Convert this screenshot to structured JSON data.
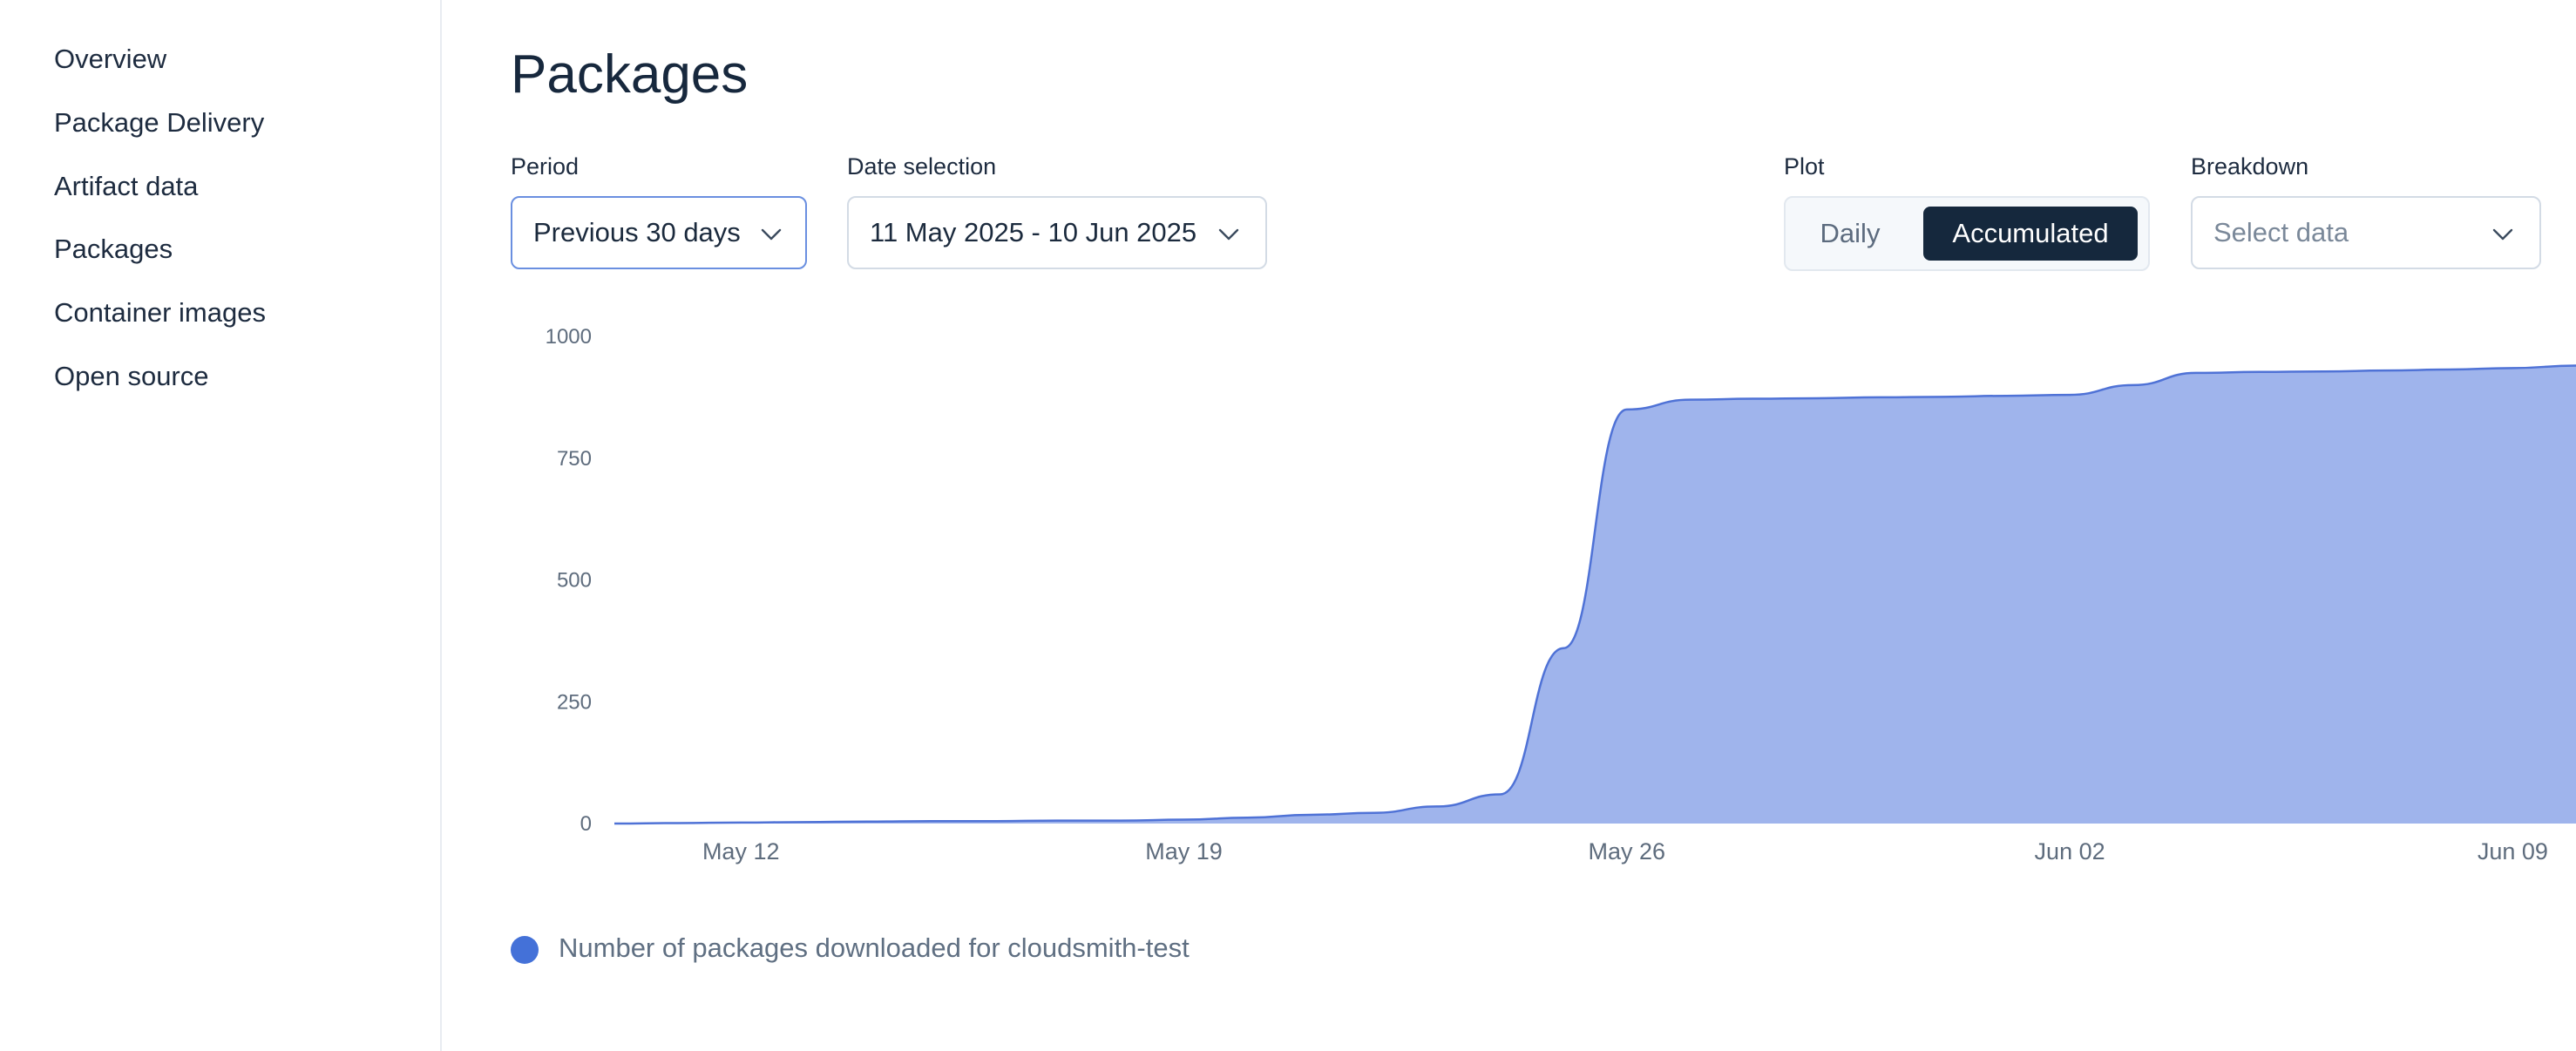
{
  "sidebar": {
    "items": [
      {
        "label": "Overview"
      },
      {
        "label": "Package Delivery"
      },
      {
        "label": "Artifact data"
      },
      {
        "label": "Packages"
      },
      {
        "label": "Container images"
      },
      {
        "label": "Open source"
      }
    ]
  },
  "main": {
    "title": "Packages",
    "period": {
      "label": "Period",
      "value": "Previous 30 days"
    },
    "date_selection": {
      "label": "Date selection",
      "value": "11 May 2025 - 10 Jun 2025"
    },
    "plot": {
      "label": "Plot",
      "options": [
        "Daily",
        "Accumulated"
      ],
      "selected": "Accumulated"
    },
    "breakdown": {
      "label": "Breakdown",
      "placeholder": "Select data"
    }
  },
  "colors": {
    "area_fill": "#9fb4ec",
    "area_stroke": "#4f72d6",
    "legend_dot": "#4471d8",
    "active_toggle": "#15283d"
  },
  "chart_data": {
    "type": "area",
    "title": "",
    "xlabel": "",
    "ylabel": "",
    "ylim": [
      0,
      1000
    ],
    "yticks": [
      0,
      250,
      500,
      750,
      1000
    ],
    "xticks": [
      "May 12",
      "May 19",
      "May 26",
      "Jun 02",
      "Jun 09"
    ],
    "grid": false,
    "legend_position": "bottom-left",
    "series": [
      {
        "name": "Number of packages downloaded for cloudsmith-test",
        "x": [
          "2025-05-10",
          "2025-05-11",
          "2025-05-12",
          "2025-05-13",
          "2025-05-14",
          "2025-05-15",
          "2025-05-16",
          "2025-05-17",
          "2025-05-18",
          "2025-05-19",
          "2025-05-20",
          "2025-05-21",
          "2025-05-22",
          "2025-05-23",
          "2025-05-24",
          "2025-05-25",
          "2025-05-26",
          "2025-05-27",
          "2025-05-28",
          "2025-05-29",
          "2025-05-30",
          "2025-05-31",
          "2025-06-01",
          "2025-06-02",
          "2025-06-03",
          "2025-06-04",
          "2025-06-05",
          "2025-06-06",
          "2025-06-07",
          "2025-06-08",
          "2025-06-09",
          "2025-06-10"
        ],
        "values": [
          0,
          1,
          2,
          3,
          4,
          5,
          5,
          6,
          6,
          8,
          12,
          18,
          22,
          35,
          60,
          360,
          850,
          870,
          872,
          873,
          875,
          876,
          878,
          880,
          900,
          925,
          927,
          928,
          930,
          932,
          935,
          940
        ]
      }
    ]
  }
}
